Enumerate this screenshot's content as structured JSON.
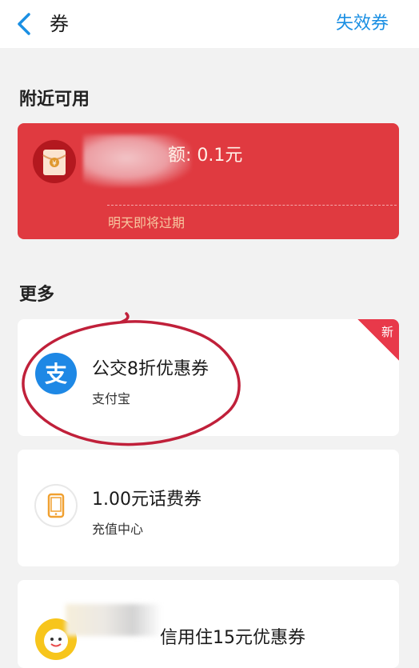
{
  "header": {
    "title": "券",
    "invalid_link": "失效券"
  },
  "sections": {
    "nearby_title": "附近可用",
    "more_title": "更多"
  },
  "red_coupon": {
    "amount_text": "额: 0.1元",
    "expire_text": "明天即将过期"
  },
  "coupons": [
    {
      "name": "公交8折优惠券",
      "merchant": "支付宝",
      "badge": "新",
      "icon": "alipay-icon"
    },
    {
      "name": "1.00元话费券",
      "merchant": "充值中心",
      "icon": "phone-icon"
    },
    {
      "name": "信用住15元优惠券",
      "icon": "emoji-icon"
    }
  ],
  "colors": {
    "accent": "#1a8fe3",
    "red_card": "#e03a40",
    "annotation": "#c0203a"
  }
}
